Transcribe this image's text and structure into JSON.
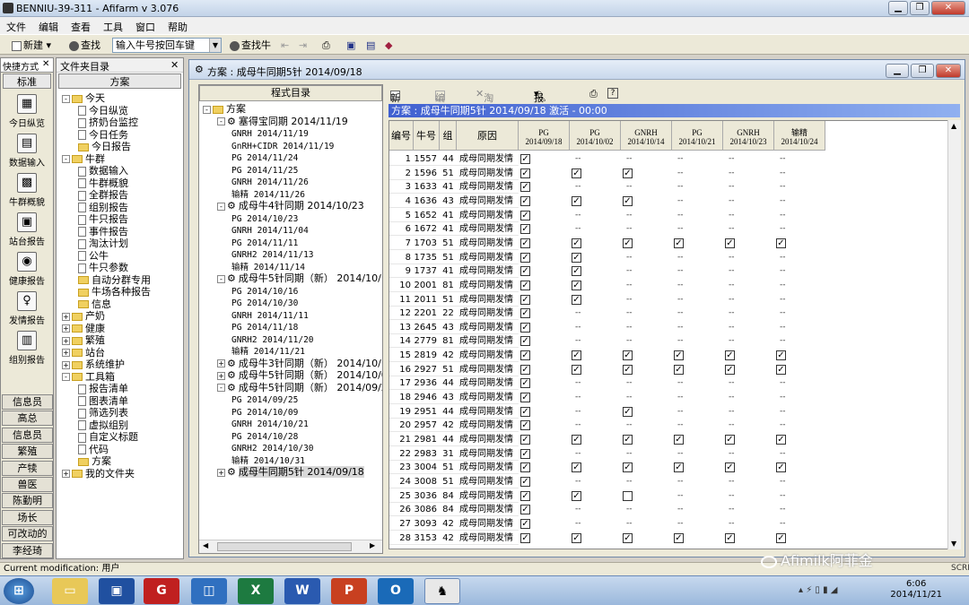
{
  "window": {
    "title": "BENNIU-39-311 - Afifarm v 3.076"
  },
  "menu": [
    "文件",
    "编辑",
    "查看",
    "工具",
    "窗口",
    "帮助"
  ],
  "toolbar": {
    "new": "新建",
    "find": "查找",
    "combo": "输入牛号按回车键",
    "findcow": "查找牛"
  },
  "quick": {
    "header": "快捷方式",
    "standard": "标准",
    "items": [
      "今日纵览",
      "数据输入",
      "牛群概貌",
      "站台报告",
      "健康报告",
      "发情报告",
      "组别报告"
    ],
    "buttons": [
      "信息员",
      "高总",
      "信息员",
      "繁殖",
      "产犊",
      "兽医",
      "陈勤明",
      "场长",
      "可改动的",
      "李经琦"
    ]
  },
  "folder": {
    "header": "文件夹目录",
    "sub": "方案",
    "tree": [
      {
        "t": "今天",
        "l": 0,
        "k": "fd",
        "b": "-"
      },
      {
        "t": "今日纵览",
        "l": 1,
        "k": "pg"
      },
      {
        "t": "挤奶台监控",
        "l": 1,
        "k": "pg"
      },
      {
        "t": "今日任务",
        "l": 1,
        "k": "pg"
      },
      {
        "t": "今日报告",
        "l": 1,
        "k": "fd"
      },
      {
        "t": "牛群",
        "l": 0,
        "k": "fd",
        "b": "-"
      },
      {
        "t": "数据输入",
        "l": 1,
        "k": "pg"
      },
      {
        "t": "牛群概貌",
        "l": 1,
        "k": "pg"
      },
      {
        "t": "全群报告",
        "l": 1,
        "k": "pg"
      },
      {
        "t": "组别报告",
        "l": 1,
        "k": "pg"
      },
      {
        "t": "牛只报告",
        "l": 1,
        "k": "pg"
      },
      {
        "t": "事件报告",
        "l": 1,
        "k": "pg"
      },
      {
        "t": "淘汰计划",
        "l": 1,
        "k": "pg"
      },
      {
        "t": "公牛",
        "l": 1,
        "k": "pg"
      },
      {
        "t": "牛只参数",
        "l": 1,
        "k": "pg"
      },
      {
        "t": "自动分群专用",
        "l": 1,
        "k": "fd"
      },
      {
        "t": "牛场各种报告",
        "l": 1,
        "k": "fd"
      },
      {
        "t": "信息",
        "l": 1,
        "k": "fd"
      },
      {
        "t": "产奶",
        "l": 0,
        "k": "fd",
        "b": "+"
      },
      {
        "t": "健康",
        "l": 0,
        "k": "fd",
        "b": "+"
      },
      {
        "t": "繁殖",
        "l": 0,
        "k": "fd",
        "b": "+"
      },
      {
        "t": "站台",
        "l": 0,
        "k": "fd",
        "b": "+"
      },
      {
        "t": "系统维护",
        "l": 0,
        "k": "fd",
        "b": "+"
      },
      {
        "t": "工具箱",
        "l": 0,
        "k": "fd",
        "b": "-"
      },
      {
        "t": "报告清单",
        "l": 1,
        "k": "pg"
      },
      {
        "t": "图表清单",
        "l": 1,
        "k": "pg"
      },
      {
        "t": "筛选列表",
        "l": 1,
        "k": "pg"
      },
      {
        "t": "虚拟组别",
        "l": 1,
        "k": "pg"
      },
      {
        "t": "自定义标题",
        "l": 1,
        "k": "pg"
      },
      {
        "t": "代码",
        "l": 1,
        "k": "pg"
      },
      {
        "t": "方案",
        "l": 1,
        "k": "fd"
      },
      {
        "t": "我的文件夹",
        "l": 0,
        "k": "fd",
        "b": "+"
      }
    ]
  },
  "doc": {
    "title": "方案 : 成母牛同期5针 2014/09/18",
    "prog_header": "程式目录",
    "prog_tree": [
      {
        "t": "方案",
        "l": 0,
        "b": "-",
        "k": "fd"
      },
      {
        "t": "塞得宝同期  2014/11/19",
        "l": 1,
        "b": "-",
        "k": "gear"
      },
      {
        "t": "GNRH  2014/11/19",
        "l": 2
      },
      {
        "t": "GnRH+CIDR  2014/11/19",
        "l": 2
      },
      {
        "t": "PG  2014/11/24",
        "l": 2
      },
      {
        "t": "PG  2014/11/25",
        "l": 2
      },
      {
        "t": "GNRH  2014/11/26",
        "l": 2
      },
      {
        "t": "输精  2014/11/26",
        "l": 2
      },
      {
        "t": "成母牛4针同期 2014/10/23",
        "l": 1,
        "b": "-",
        "k": "gear"
      },
      {
        "t": "PG  2014/10/23",
        "l": 2
      },
      {
        "t": "GNRH  2014/11/04",
        "l": 2
      },
      {
        "t": "PG  2014/11/11",
        "l": 2
      },
      {
        "t": "GNRH2  2014/11/13",
        "l": 2
      },
      {
        "t": "输精  2014/11/14",
        "l": 2
      },
      {
        "t": "成母牛5针同期（新） 2014/10/16",
        "l": 1,
        "b": "-",
        "k": "gear"
      },
      {
        "t": "PG  2014/10/16",
        "l": 2
      },
      {
        "t": "PG  2014/10/30",
        "l": 2
      },
      {
        "t": "GNRH  2014/11/11",
        "l": 2
      },
      {
        "t": "PG  2014/11/18",
        "l": 2
      },
      {
        "t": "GNRH2  2014/11/20",
        "l": 2
      },
      {
        "t": "输精  2014/11/21",
        "l": 2
      },
      {
        "t": "成母牛3针同期（新） 2014/10/14",
        "l": 1,
        "b": "+",
        "k": "gear"
      },
      {
        "t": "成母牛5针同期（新） 2014/10/02",
        "l": 1,
        "b": "+",
        "k": "gear"
      },
      {
        "t": "成母牛5针同期（新） 2014/09/25",
        "l": 1,
        "b": "-",
        "k": "gear"
      },
      {
        "t": "PG  2014/09/25",
        "l": 2
      },
      {
        "t": "PG  2014/10/09",
        "l": 2
      },
      {
        "t": "GNRH  2014/10/21",
        "l": 2
      },
      {
        "t": "PG  2014/10/28",
        "l": 2
      },
      {
        "t": "GNRH2  2014/10/30",
        "l": 2
      },
      {
        "t": "输精  2014/10/31",
        "l": 2
      },
      {
        "t": "成母牛同期5针  2014/09/18",
        "l": 1,
        "b": "+",
        "k": "gear",
        "sel": true
      }
    ],
    "rtool": {
      "new": "新建",
      "edit": "编辑",
      "cull": "淘汰此牛",
      "report": "报告"
    },
    "status_bar": "方案 : 成母牛同期5针 2014/09/18 激活 - 00:00",
    "columns": [
      "编号",
      "牛号",
      "组",
      "原因"
    ],
    "date_cols": [
      [
        "PG",
        "2014/09/18"
      ],
      [
        "PG",
        "2014/10/02"
      ],
      [
        "GNRH",
        "2014/10/14"
      ],
      [
        "PG",
        "2014/10/21"
      ],
      [
        "GNRH",
        "2014/10/23"
      ],
      [
        "输精",
        "2014/10/24"
      ]
    ],
    "rows": [
      [
        "1",
        "1557",
        "44",
        "成母同期发情",
        "1-----"
      ],
      [
        "2",
        "1596",
        "51",
        "成母同期发情",
        "111---"
      ],
      [
        "3",
        "1633",
        "41",
        "成母同期发情",
        "1-----"
      ],
      [
        "4",
        "1636",
        "43",
        "成母同期发情",
        "111---"
      ],
      [
        "5",
        "1652",
        "41",
        "成母同期发情",
        "1-----"
      ],
      [
        "6",
        "1672",
        "41",
        "成母同期发情",
        "1-----"
      ],
      [
        "7",
        "1703",
        "51",
        "成母同期发情",
        "111111"
      ],
      [
        "8",
        "1735",
        "51",
        "成母同期发情",
        "11----"
      ],
      [
        "9",
        "1737",
        "41",
        "成母同期发情",
        "11----"
      ],
      [
        "10",
        "2001",
        "81",
        "成母同期发情",
        "11----"
      ],
      [
        "11",
        "2011",
        "51",
        "成母同期发情",
        "11----"
      ],
      [
        "12",
        "2201",
        "22",
        "成母同期发情",
        "1-----"
      ],
      [
        "13",
        "2645",
        "43",
        "成母同期发情",
        "1-----"
      ],
      [
        "14",
        "2779",
        "81",
        "成母同期发情",
        "1-----"
      ],
      [
        "15",
        "2819",
        "42",
        "成母同期发情",
        "111111"
      ],
      [
        "16",
        "2927",
        "51",
        "成母同期发情",
        "111111"
      ],
      [
        "17",
        "2936",
        "44",
        "成母同期发情",
        "1-----"
      ],
      [
        "18",
        "2946",
        "43",
        "成母同期发情",
        "1-----"
      ],
      [
        "19",
        "2951",
        "44",
        "成母同期发情",
        "1-1---"
      ],
      [
        "20",
        "2957",
        "42",
        "成母同期发情",
        "1-----"
      ],
      [
        "21",
        "2981",
        "44",
        "成母同期发情",
        "111111"
      ],
      [
        "22",
        "2983",
        "31",
        "成母同期发情",
        "1-----"
      ],
      [
        "23",
        "3004",
        "51",
        "成母同期发情",
        "111111"
      ],
      [
        "24",
        "3008",
        "51",
        "成母同期发情",
        "1-----"
      ],
      [
        "25",
        "3036",
        "84",
        "成母同期发情",
        "110---"
      ],
      [
        "26",
        "3086",
        "84",
        "成母同期发情",
        "1-----"
      ],
      [
        "27",
        "3093",
        "42",
        "成母同期发情",
        "1-----"
      ],
      [
        "28",
        "3153",
        "42",
        "成母同期发情",
        "111111"
      ]
    ]
  },
  "statusbar": "Current modification: 用户",
  "taskbar": {
    "time": "6:06",
    "date": "2014/11/21",
    "scrl": "SCRL"
  },
  "watermark": "Afimilk阿菲金"
}
